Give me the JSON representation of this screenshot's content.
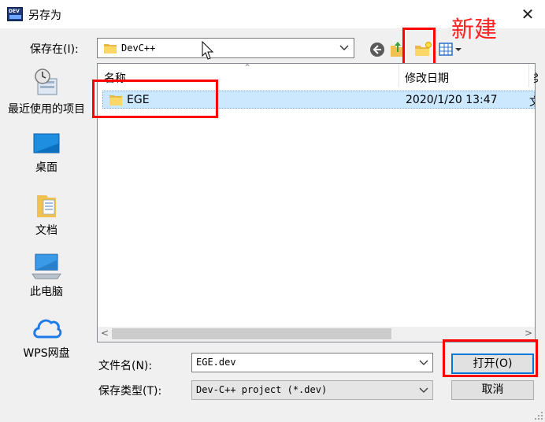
{
  "window": {
    "title": "另存为",
    "app_icon_text": "DEV"
  },
  "toolbar": {
    "save_in_label": "保存在(I):",
    "save_in_value": "DevC++"
  },
  "annotations": {
    "new_label": "新建",
    "highlight_color": "#ff0000"
  },
  "places": [
    {
      "label": "最近使用的项目",
      "icon": "recent-icon"
    },
    {
      "label": "桌面",
      "icon": "desktop-icon"
    },
    {
      "label": "文档",
      "icon": "documents-icon"
    },
    {
      "label": "此电脑",
      "icon": "computer-icon"
    },
    {
      "label": "WPS网盘",
      "icon": "cloud-icon"
    }
  ],
  "list": {
    "columns": [
      "名称",
      "修改日期",
      "类"
    ],
    "rows": [
      {
        "name": "EGE",
        "modified": "2020/1/20 13:47",
        "type_partial": "文"
      }
    ]
  },
  "bottom": {
    "filename_label": "文件名(N):",
    "filename_value": "EGE.dev",
    "filetype_label": "保存类型(T):",
    "filetype_value": "Dev-C++ project (*.dev)",
    "open_label": "打开(O)",
    "cancel_label": "取消"
  },
  "colors": {
    "selection": "#cce8ff",
    "accent": "#0078d7"
  }
}
